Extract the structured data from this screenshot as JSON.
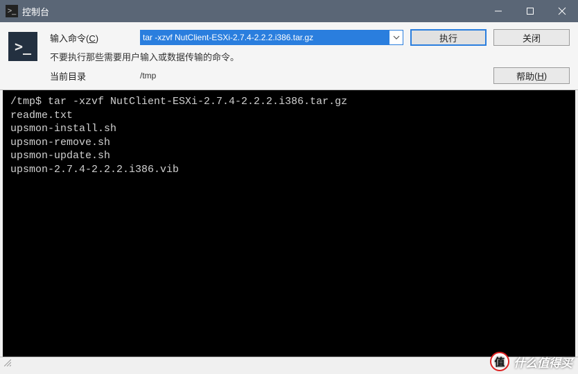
{
  "window": {
    "title": "控制台"
  },
  "toolbar": {
    "input_label": "输入命令",
    "input_accel": "C",
    "command_value": "tar -xzvf NutClient-ESXi-2.7.4-2.2.2.i386.tar.gz",
    "hint": "不要执行那些需要用户输入或数据传输的命令。",
    "cwd_label": "当前目录",
    "cwd_value": "/tmp",
    "exec_label": "执行",
    "close_label": "关闭",
    "help_label": "帮助",
    "help_accel": "H"
  },
  "terminal": {
    "lines": [
      "/tmp$ tar -xzvf NutClient-ESXi-2.7.4-2.2.2.i386.tar.gz",
      "readme.txt",
      "upsmon-install.sh",
      "upsmon-remove.sh",
      "upsmon-update.sh",
      "upsmon-2.7.4-2.2.2.i386.vib"
    ]
  },
  "watermark": {
    "badge": "值",
    "text": "什么值得买"
  }
}
